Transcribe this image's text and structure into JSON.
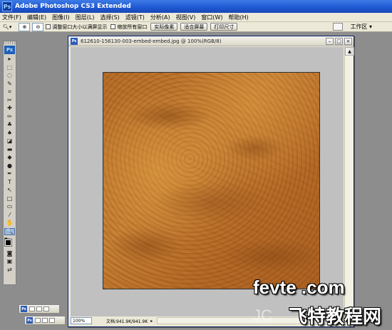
{
  "app": {
    "title": "Adobe Photoshop CS3 Extended",
    "logo": "Ps"
  },
  "menu": [
    "文件(F)",
    "编辑(E)",
    "图像(I)",
    "图层(L)",
    "选择(S)",
    "滤镜(T)",
    "分析(A)",
    "视图(V)",
    "窗口(W)",
    "帮助(H)"
  ],
  "options": {
    "zoom_tool_icon": "magnifier-icon",
    "check_resize": "调整窗口大小以满屏显示",
    "check_zoom_all": "缩放所有窗口",
    "btn_actual_pixels": "实际像素",
    "btn_fit_screen": "适合屏幕",
    "btn_print_size": "打印尺寸",
    "workspace": "工作区 ▾"
  },
  "tools": {
    "icons": [
      "move-icon",
      "marquee-icon",
      "lasso-icon",
      "quick-select-icon",
      "crop-icon",
      "slice-icon",
      "healing-icon",
      "brush-icon",
      "clone-stamp-icon",
      "history-brush-icon",
      "eraser-icon",
      "gradient-icon",
      "blur-icon",
      "dodge-icon",
      "pen-icon",
      "type-icon",
      "path-select-icon",
      "shape-icon",
      "notes-icon",
      "eyedropper-icon",
      "hand-icon",
      "zoom-icon"
    ],
    "glyphs": [
      "▸",
      "⬚",
      "◌",
      "✎",
      "⌗",
      "✂",
      "✚",
      "✏",
      "♣",
      "♠",
      "◪",
      "▬",
      "◆",
      "●",
      "✒",
      "T",
      "↖",
      "□",
      "▭",
      "⁄",
      "✋",
      "🔍"
    ],
    "active_index": 21
  },
  "document": {
    "title": "612610-156130-003-embed-embed.jpg @ 100%(RGB/8)",
    "zoom": "100%",
    "doc_info": "文档:941.9K/941.9K",
    "icon": "Ps"
  },
  "watermark": {
    "top": "fevte .com",
    "bottom": "飞特教程网",
    "faint": "JC"
  }
}
